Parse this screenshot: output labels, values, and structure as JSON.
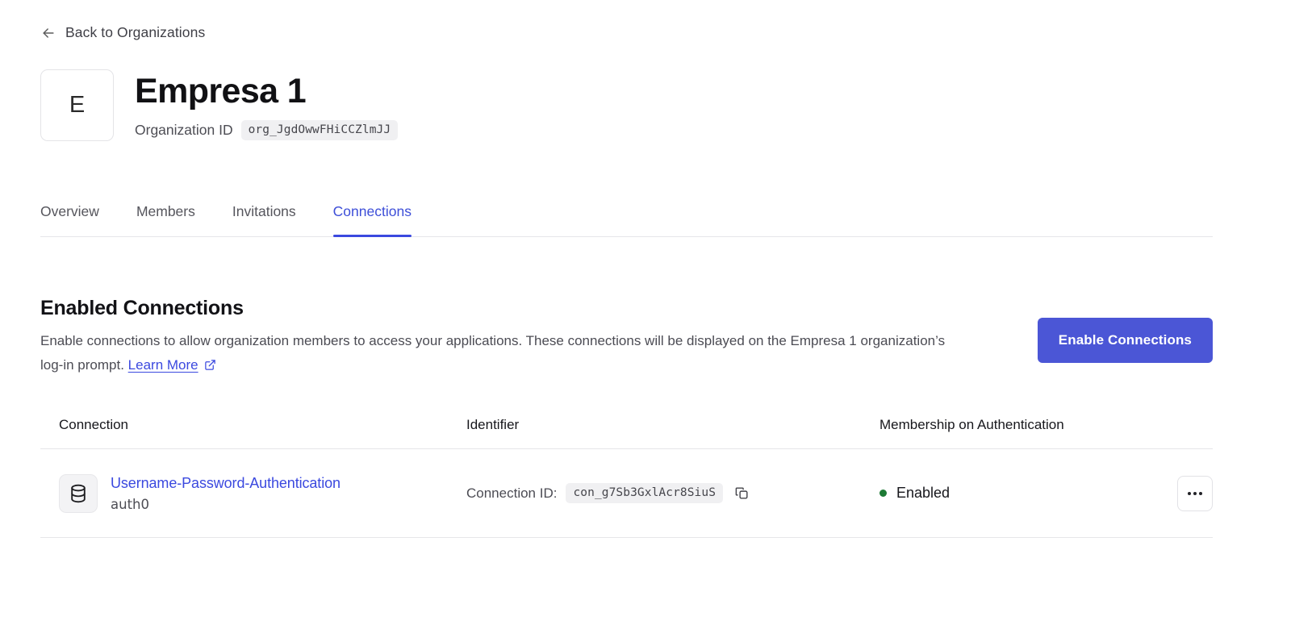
{
  "back": {
    "label": "Back to Organizations",
    "icon": "arrow-left-icon"
  },
  "organization": {
    "avatar_initial": "E",
    "name": "Empresa 1",
    "id_label": "Organization ID",
    "id_value": "org_JgdOwwFHiCCZlmJJ"
  },
  "tabs": [
    {
      "label": "Overview",
      "active": false
    },
    {
      "label": "Members",
      "active": false
    },
    {
      "label": "Invitations",
      "active": false
    },
    {
      "label": "Connections",
      "active": true
    }
  ],
  "section": {
    "title": "Enabled Connections",
    "description_part1": "Enable connections to allow organization members to access your applications. These connections will be displayed on the Empresa 1 organization’s log-in prompt.",
    "learn_more_label": "Learn More",
    "external_link_icon": "external-link-icon",
    "enable_button_label": "Enable Connections"
  },
  "table": {
    "columns": [
      "Connection",
      "Identifier",
      "Membership on Authentication"
    ],
    "rows": [
      {
        "icon": "database-icon",
        "connection_name": "Username-Password-Authentication",
        "strategy": "auth0",
        "identifier_label": "Connection ID:",
        "identifier_value": "con_g7Sb3GxlAcr8SiuS",
        "copy_icon": "copy-icon",
        "status": "Enabled",
        "status_color": "#1d7a35",
        "actions_icon": "ellipsis-icon"
      }
    ]
  },
  "colors": {
    "accent": "#3b49df",
    "button": "#4b56d6",
    "status_green": "#1d7a35",
    "border": "#e6e6e9"
  }
}
